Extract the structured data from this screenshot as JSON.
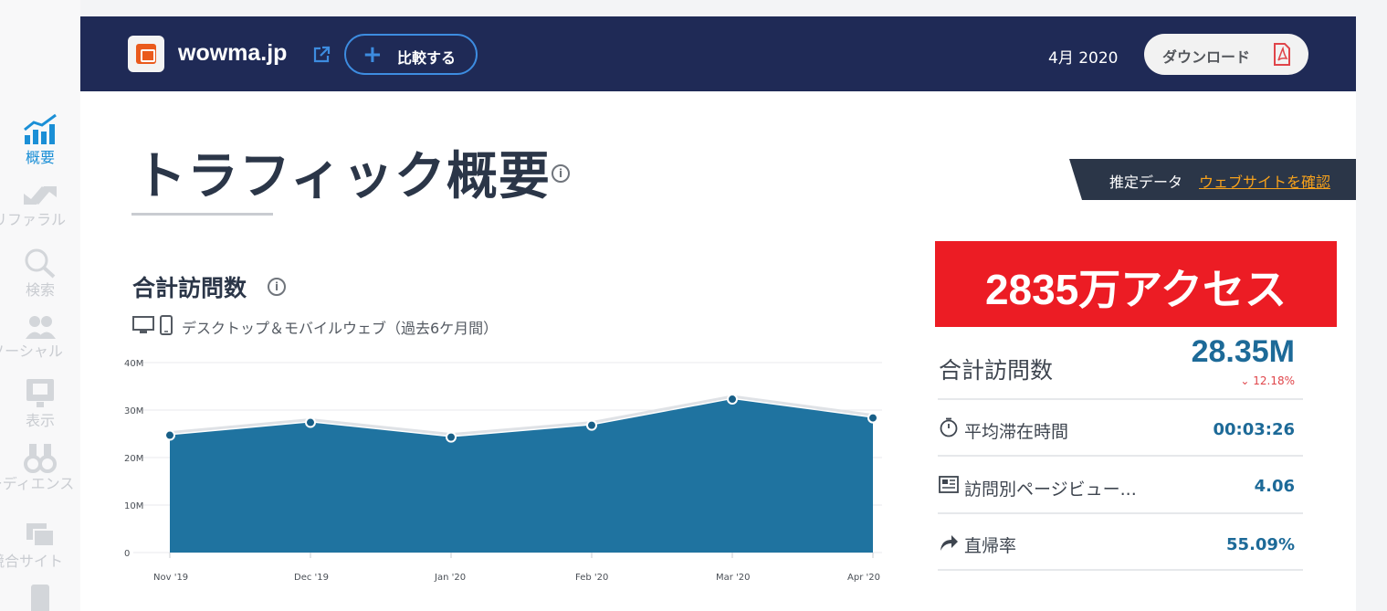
{
  "app": {
    "site_name": "wowma.jp",
    "compare_label": "比較する",
    "date_label": "4月 2020",
    "download_label": "ダウンロード"
  },
  "sidebar": {
    "items": [
      {
        "label": "概要",
        "icon": "bar-chart-icon",
        "active": true
      },
      {
        "label": "リファラル",
        "icon": "referral-arrows-icon",
        "active": false
      },
      {
        "label": "検索",
        "icon": "search-icon",
        "active": false
      },
      {
        "label": "ソーシャル",
        "icon": "social-people-icon",
        "active": false
      },
      {
        "label": "表示",
        "icon": "display-icon",
        "active": false
      },
      {
        "label": "オーディエンス",
        "icon": "binoculars-icon",
        "active": false
      },
      {
        "label": "競合サイト",
        "icon": "competitors-icon",
        "active": false
      },
      {
        "label": "",
        "icon": "mobile-icon",
        "active": false
      }
    ]
  },
  "page": {
    "title": "トラフィック概要",
    "estimate_label": "推定データ",
    "verify_link": "ウェブサイトを確認"
  },
  "section": {
    "title": "合計訪問数",
    "device_label": "デスクトップ＆モバイルウェブ（過去6ケ月間）"
  },
  "chart_data": {
    "type": "area",
    "categories": [
      "Nov '19",
      "Dec '19",
      "Jan '20",
      "Feb '20",
      "Mar '20",
      "Apr '20"
    ],
    "values": [
      24.7,
      27.4,
      24.3,
      26.8,
      32.3,
      28.35
    ],
    "yticks": [
      "0",
      "10M",
      "20M",
      "30M",
      "40M"
    ],
    "ylim": [
      0,
      40
    ],
    "unit": "M",
    "grid": true,
    "color": "#1f73a0"
  },
  "kpi": {
    "banner_text": "2835万アクセス",
    "main_label": "合計訪問数",
    "main_value": "28.35M",
    "main_change": "12.18%",
    "rows": [
      {
        "icon": "stopwatch-icon",
        "label": "平均滞在時間",
        "value": "00:03:26"
      },
      {
        "icon": "pageviews-icon",
        "label": "訪問別ページビュー...",
        "value": "4.06"
      },
      {
        "icon": "bounce-arrow-icon",
        "label": "直帰率",
        "value": "55.09%"
      }
    ]
  },
  "colors": {
    "navy": "#1f2a56",
    "accent_blue": "#3d8ce0",
    "banner_red": "#ec1c24",
    "value_blue": "#1d6a98",
    "link_orange": "#f8a21b"
  }
}
